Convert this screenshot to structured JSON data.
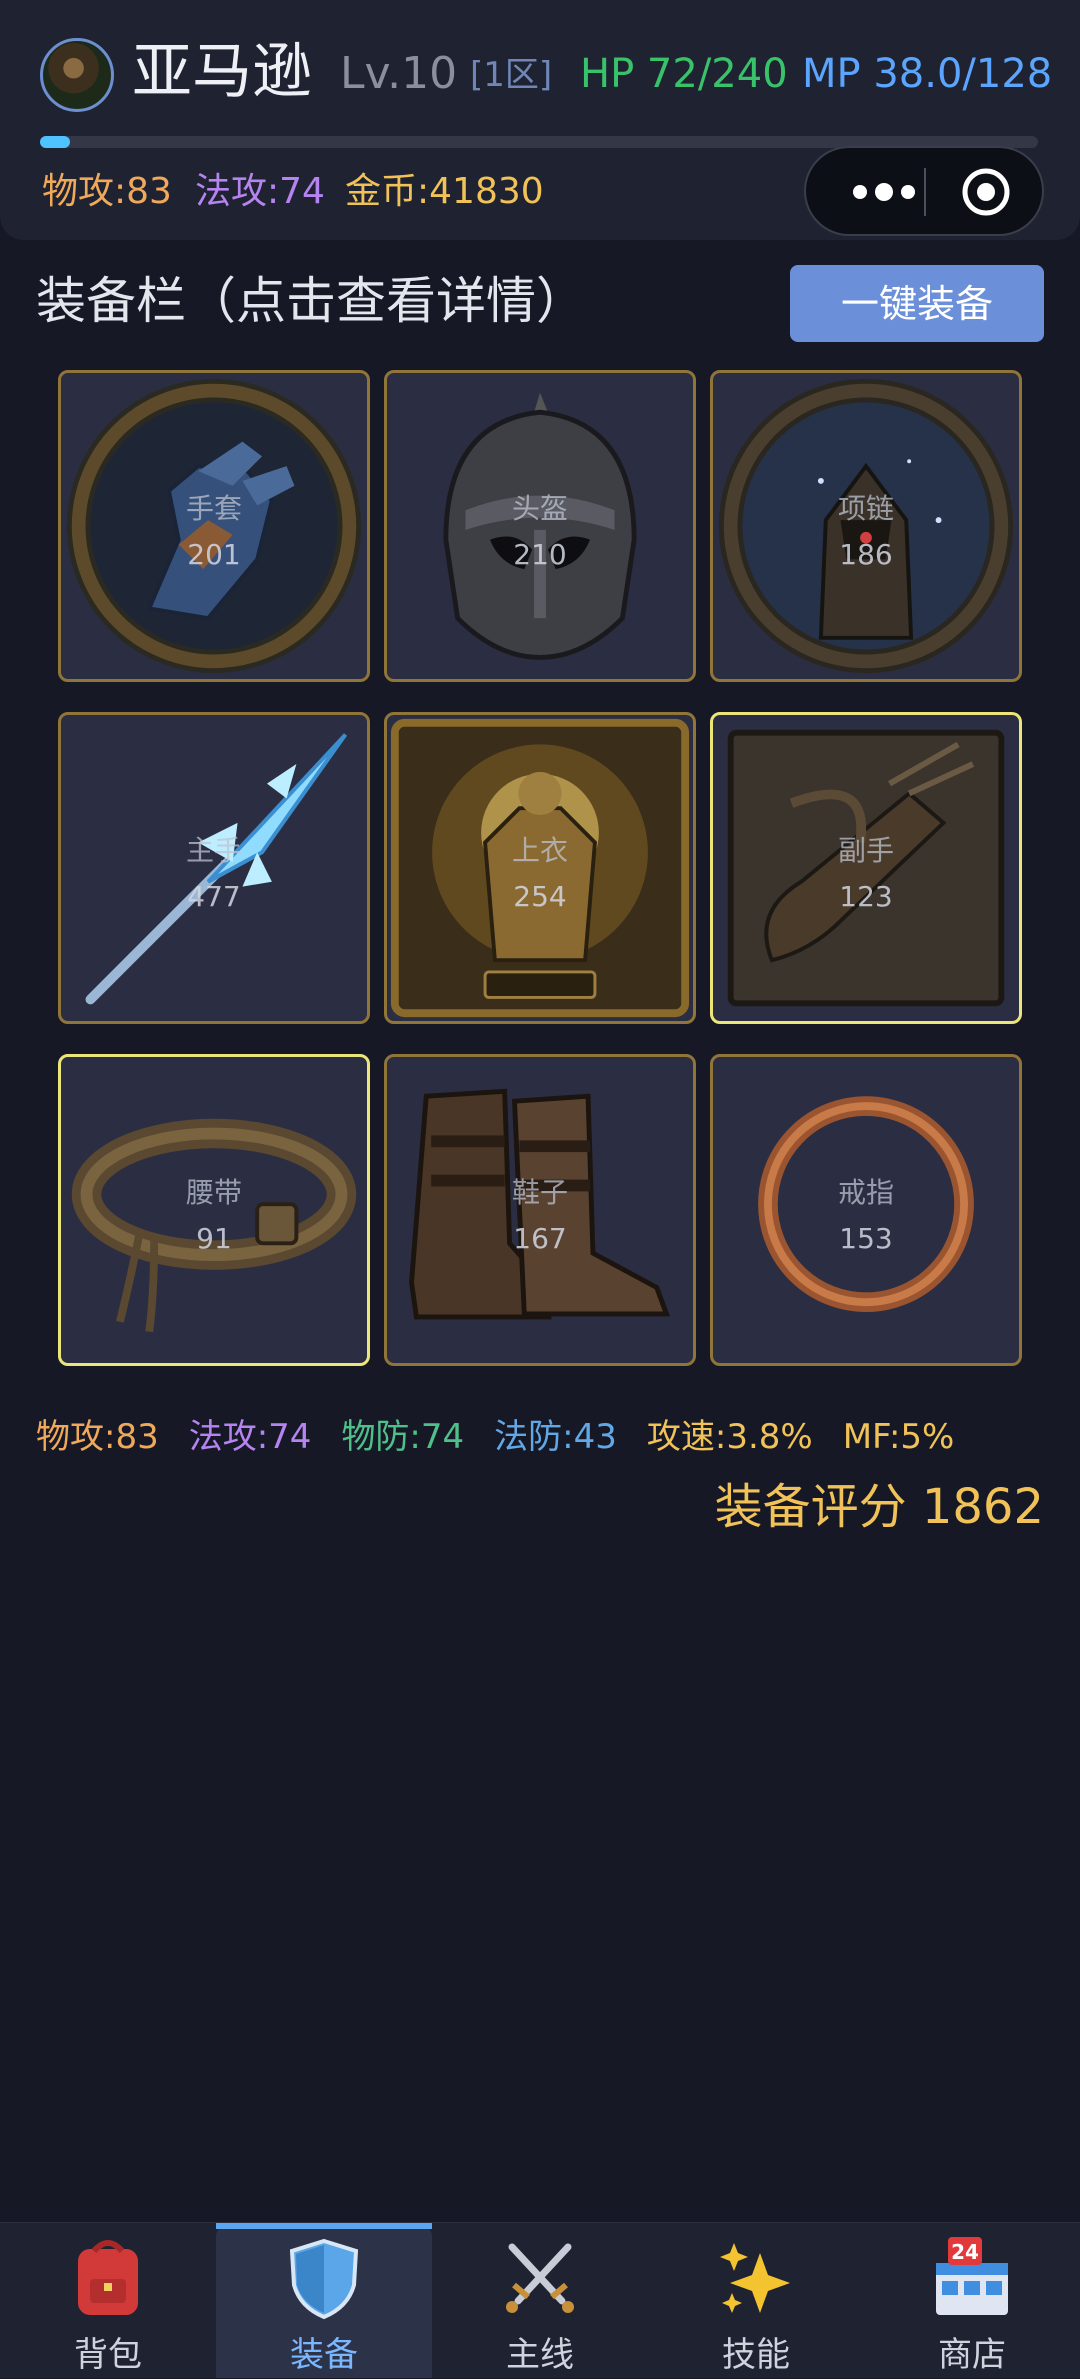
{
  "header": {
    "name": "亚马逊",
    "level": "Lv.10",
    "zone": "[1区]",
    "hp": "HP 72/240",
    "mp": "MP 38.0/128",
    "xp_fraction": 0.03,
    "phys_atk": "物攻:83",
    "mag_atk": "法攻:74",
    "gold": "金币:41830",
    "menu_icon": "more-dots-icon",
    "close_icon": "target-icon"
  },
  "section": {
    "title": "装备栏（点击查看详情）",
    "equip_all": "一键装备"
  },
  "slots": [
    {
      "label": "手套",
      "score": "201",
      "icon": "gauntlet-icon"
    },
    {
      "label": "头盔",
      "score": "210",
      "icon": "helmet-icon"
    },
    {
      "label": "项链",
      "score": "186",
      "icon": "armor-amulet-icon"
    },
    {
      "label": "主手",
      "score": "477",
      "icon": "ice-spear-icon"
    },
    {
      "label": "上衣",
      "score": "254",
      "icon": "golden-armor-icon"
    },
    {
      "label": "副手",
      "score": "123",
      "icon": "quiver-icon"
    },
    {
      "label": "腰带",
      "score": "91",
      "icon": "belt-icon"
    },
    {
      "label": "鞋子",
      "score": "167",
      "icon": "boots-icon"
    },
    {
      "label": "戒指",
      "score": "153",
      "icon": "ring-icon"
    }
  ],
  "stats": {
    "phys_atk": "物攻:83",
    "mag_atk": "法攻:74",
    "phys_def": "物防:74",
    "mag_def": "法防:43",
    "atk_speed": "攻速:3.8%",
    "mf": "MF:5%",
    "rating": "装备评分 1862"
  },
  "colors": {
    "accent": "#6b90d9",
    "gold": "#f0c257",
    "hp": "#38c36b",
    "mp": "#5ca5ff",
    "phys": "#f0a85a",
    "magic": "#b584f0",
    "defense": "#4fc08a",
    "magic_def": "#62a8e6"
  },
  "nav": [
    {
      "label": "背包",
      "icon": "backpack-icon"
    },
    {
      "label": "装备",
      "icon": "shield-icon",
      "active": true
    },
    {
      "label": "主线",
      "icon": "crossed-swords-icon"
    },
    {
      "label": "技能",
      "icon": "sparkles-icon"
    },
    {
      "label": "商店",
      "icon": "store-icon"
    }
  ]
}
